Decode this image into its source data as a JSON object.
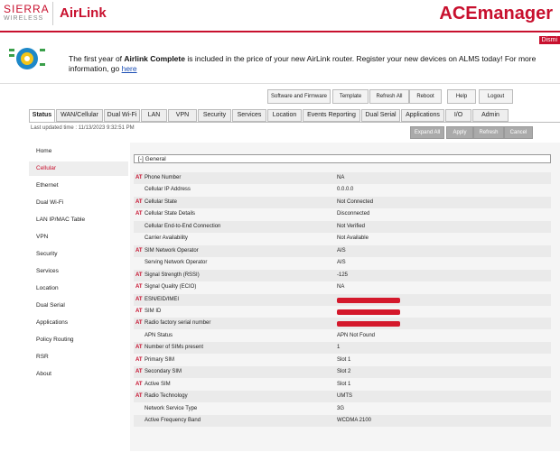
{
  "header": {
    "logo_sierra_line1": "SIERRA",
    "logo_sierra_line2": "WIRELESS",
    "logo_airlink": "AirLink",
    "brand": "ACEmanager",
    "dismiss": "Dismi"
  },
  "banner": {
    "text_before": "The first year of ",
    "text_bold": "Airlink Complete",
    "text_after": " is included in the price of your new AirLink router. Register your new devices on ALMS today! For more information, go ",
    "link": "here"
  },
  "toolbar": [
    "Software and Firmware",
    "Template",
    "Refresh All",
    "Reboot",
    "Help",
    "Logout"
  ],
  "tabs": [
    "Status",
    "WAN/Cellular",
    "Dual Wi-Fi",
    "LAN",
    "VPN",
    "Security",
    "Services",
    "Location",
    "Events Reporting",
    "Dual Serial",
    "Applications",
    "I/O",
    "Admin"
  ],
  "last_updated": "Last updated time : 11/13/2023 9:32:51 PM",
  "actions": [
    "Expand All",
    "Apply",
    "Refresh",
    "Cancel"
  ],
  "sidebar": [
    "Home",
    "Cellular",
    "Ethernet",
    "Dual Wi-Fi",
    "LAN IP/MAC Table",
    "VPN",
    "Security",
    "Services",
    "Location",
    "Dual Serial",
    "Applications",
    "Policy Routing",
    "RSR",
    "About"
  ],
  "section_title": "[-] General",
  "at_marker": "AT",
  "rows": [
    {
      "at": true,
      "label": "Phone Number",
      "value": "NA"
    },
    {
      "at": false,
      "label": "Cellular IP Address",
      "value": "0.0.0.0"
    },
    {
      "at": true,
      "label": "Cellular State",
      "value": "Not Connected"
    },
    {
      "at": true,
      "label": "Cellular State Details",
      "value": "Disconnected"
    },
    {
      "at": false,
      "label": "Cellular End-to-End Connection",
      "value": "Not Verified"
    },
    {
      "at": false,
      "label": "Carrier Availability",
      "value": "Not Available"
    },
    {
      "at": true,
      "label": "SIM Network Operator",
      "value": "AIS"
    },
    {
      "at": false,
      "label": "Serving Network Operator",
      "value": "AIS"
    },
    {
      "at": true,
      "label": "Signal Strength (RSSI)",
      "value": "-125"
    },
    {
      "at": true,
      "label": "Signal Quality (ECIO)",
      "value": "NA"
    },
    {
      "at": true,
      "label": "ESN/EID/IMEI",
      "value": "",
      "redacted": true
    },
    {
      "at": true,
      "label": "SIM ID",
      "value": "",
      "redacted": true
    },
    {
      "at": true,
      "label": "Radio factory serial number",
      "value": "",
      "redacted": true
    },
    {
      "at": false,
      "label": "APN Status",
      "value": "APN Not Found"
    },
    {
      "at": true,
      "label": "Number of SIMs present",
      "value": "1"
    },
    {
      "at": true,
      "label": "Primary SIM",
      "value": "Slot 1"
    },
    {
      "at": true,
      "label": "Secondary SIM",
      "value": "Slot 2"
    },
    {
      "at": true,
      "label": "Active SIM",
      "value": "Slot 1"
    },
    {
      "at": true,
      "label": "Radio Technology",
      "value": "UMTS"
    },
    {
      "at": false,
      "label": "Network Service Type",
      "value": "3G"
    },
    {
      "at": false,
      "label": "Active Frequency Band",
      "value": "WCDMA 2100"
    }
  ],
  "colors": {
    "accent": "#c8102e",
    "link": "#1a4db3"
  }
}
